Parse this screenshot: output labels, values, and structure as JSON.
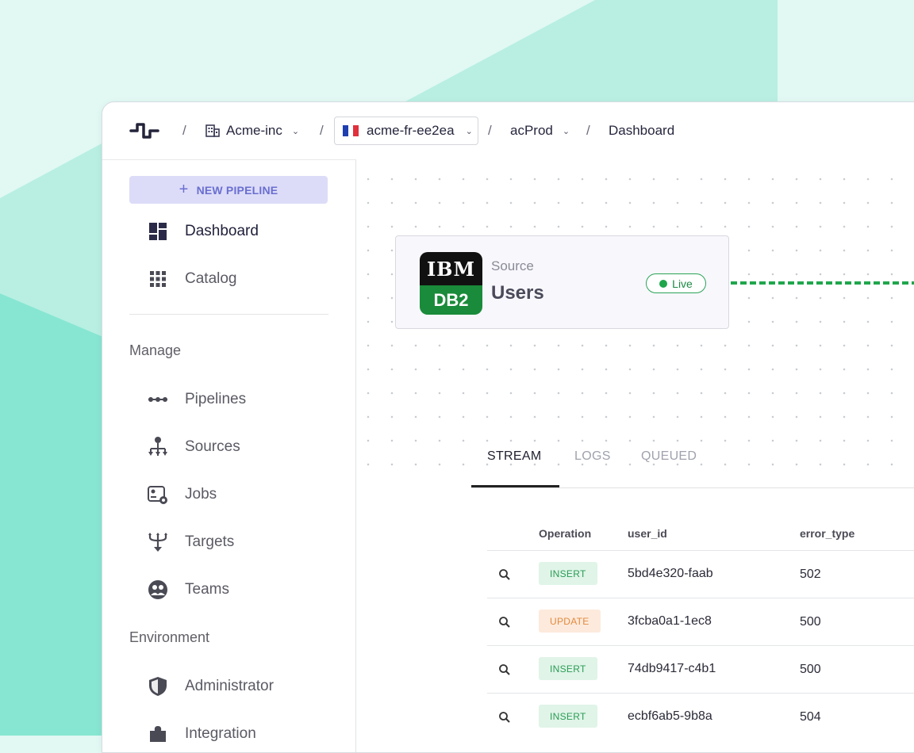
{
  "topbar": {
    "org": "Acme-inc",
    "environment": "acme-fr-ee2ea",
    "project": "acProd",
    "page": "Dashboard",
    "separator": "/"
  },
  "sidebar": {
    "new_pipeline_label": "NEW PIPELINE",
    "top_items": [
      {
        "label": "Dashboard",
        "icon": "dashboard-icon"
      },
      {
        "label": "Catalog",
        "icon": "grid-icon"
      }
    ],
    "manage_heading": "Manage",
    "manage_items": [
      {
        "label": "Pipelines",
        "icon": "pipeline-icon"
      },
      {
        "label": "Sources",
        "icon": "sources-icon"
      },
      {
        "label": "Jobs",
        "icon": "jobs-icon"
      },
      {
        "label": "Targets",
        "icon": "targets-icon"
      },
      {
        "label": "Teams",
        "icon": "teams-icon"
      }
    ],
    "environment_heading": "Environment",
    "environment_items": [
      {
        "label": "Administrator",
        "icon": "shield-icon"
      },
      {
        "label": "Integration",
        "icon": "puzzle-icon"
      }
    ]
  },
  "source_card": {
    "logo_top": "IBM",
    "logo_bottom": "DB2",
    "type": "Source",
    "name": "Users",
    "status": "Live"
  },
  "tabs": [
    "STREAM",
    "LOGS",
    "QUEUED"
  ],
  "table": {
    "columns": [
      "Operation",
      "user_id",
      "error_type"
    ],
    "rows": [
      {
        "operation": "INSERT",
        "user_id": "5bd4e320-faab",
        "error_type": "502"
      },
      {
        "operation": "UPDATE",
        "user_id": "3fcba0a1-1ec8",
        "error_type": "500"
      },
      {
        "operation": "INSERT",
        "user_id": "74db9417-c4b1",
        "error_type": "500"
      },
      {
        "operation": "INSERT",
        "user_id": "ecbf6ab5-9b8a",
        "error_type": "504"
      }
    ]
  },
  "colors": {
    "accent": "#6a6ed0",
    "live": "#1fa64c",
    "insert": "#2a9c55",
    "update": "#e38a3f"
  }
}
